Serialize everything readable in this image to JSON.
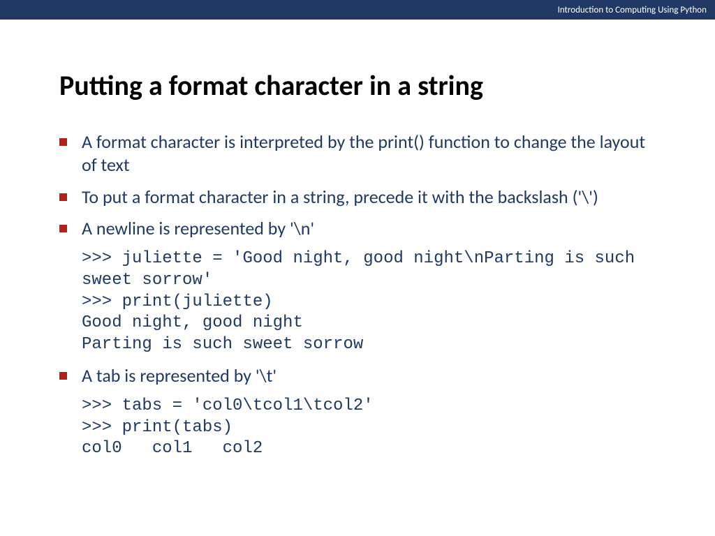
{
  "header": {
    "course": "Introduction to Computing Using Python"
  },
  "title": "Putting a format character in a string",
  "bullets": {
    "b1": "A format character is interpreted by the print() function to change the layout of text",
    "b2": "To put a format character in a string, precede it with the backslash ('\\')",
    "b3": "A newline is represented by '\\n'",
    "b4": "A tab is represented by '\\t'"
  },
  "code": {
    "block1": ">>> juliette = 'Good night, good night\\nParting is such sweet sorrow'\n>>> print(juliette)\nGood night, good night\nParting is such sweet sorrow",
    "block2": ">>> tabs = 'col0\\tcol1\\tcol2'\n>>> print(tabs)\ncol0   col1   col2"
  }
}
